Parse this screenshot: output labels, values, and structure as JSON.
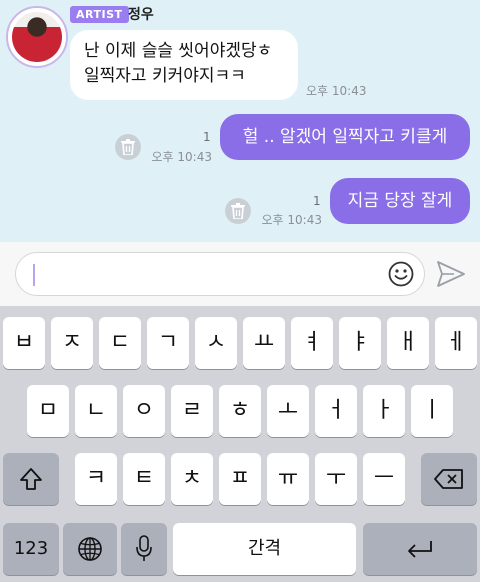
{
  "chat": {
    "sender_badge": "ARTIST",
    "sender_name": "정우",
    "incoming": {
      "line1": "난 이제 슬슬 씻어야겠당ㅎ",
      "line2": "일찍자고 키커야지ㅋㅋ",
      "time": "오후 10:43"
    },
    "outgoing": [
      {
        "text": "헐 .. 알겠어 일찍자고 키클게",
        "read_count": "1",
        "time": "오후 10:43"
      },
      {
        "text": "지금 당장 잘게",
        "read_count": "1",
        "time": "오후 10:43"
      }
    ]
  },
  "input": {
    "value": "",
    "emoji_icon": "smiley-icon",
    "send_icon": "paper-plane-icon"
  },
  "keyboard": {
    "row1": [
      "ㅂ",
      "ㅈ",
      "ㄷ",
      "ㄱ",
      "ㅅ",
      "ㅛ",
      "ㅕ",
      "ㅑ",
      "ㅐ",
      "ㅔ"
    ],
    "row2": [
      "ㅁ",
      "ㄴ",
      "ㅇ",
      "ㄹ",
      "ㅎ",
      "ㅗ",
      "ㅓ",
      "ㅏ",
      "ㅣ"
    ],
    "row3": [
      "ㅋ",
      "ㅌ",
      "ㅊ",
      "ㅍ",
      "ㅠ",
      "ㅜ",
      "ㅡ"
    ],
    "numbers_label": "123",
    "space_label": "간격",
    "icons": {
      "shift": "shift-icon",
      "backspace": "backspace-icon",
      "globe": "globe-icon",
      "mic": "microphone-icon",
      "return": "return-icon"
    }
  },
  "colors": {
    "chat_bg": "#dff1f6",
    "bubble_out": "#8a6ee8",
    "badge": "#9a7ef0"
  }
}
